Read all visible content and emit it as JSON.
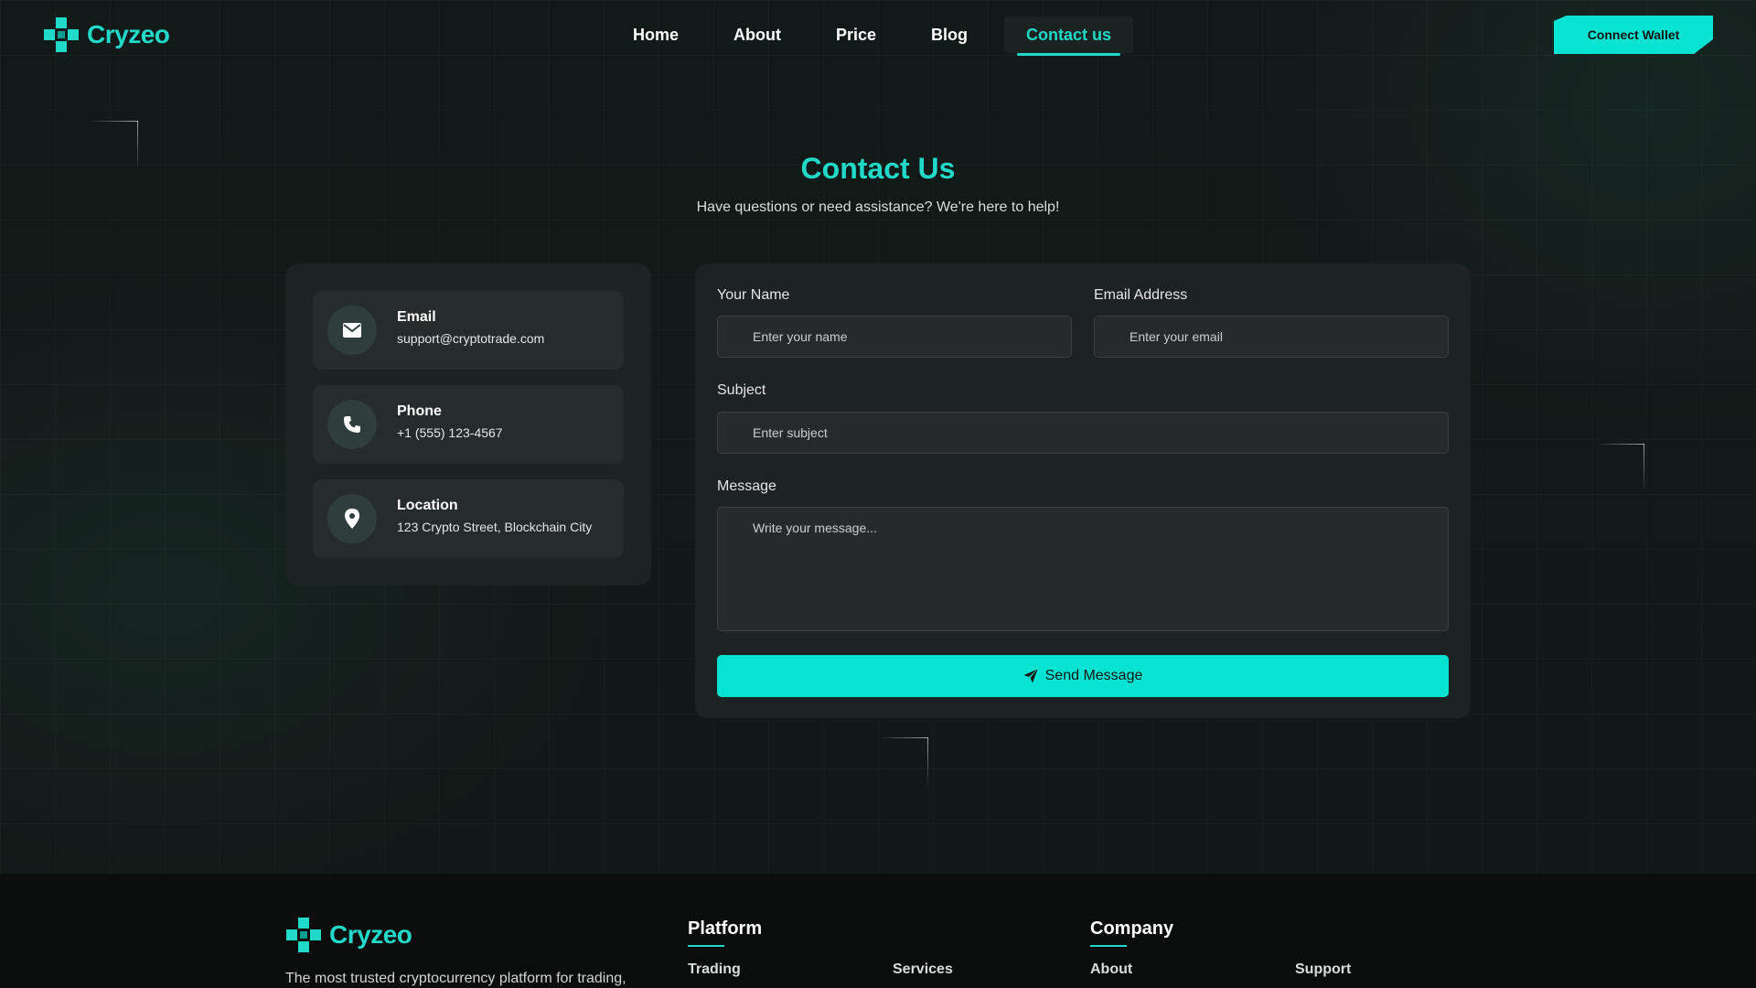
{
  "brand": {
    "name": "Cryzeo",
    "accent": "#20d9c8"
  },
  "nav": {
    "items": [
      {
        "label": "Home"
      },
      {
        "label": "About"
      },
      {
        "label": "Price"
      },
      {
        "label": "Blog"
      },
      {
        "label": "Contact us",
        "active": true
      }
    ],
    "connect_label": "Connect Wallet"
  },
  "hero": {
    "title": "Contact Us",
    "subtitle": "Have questions or need assistance? We're here to help!"
  },
  "contact_info": [
    {
      "label": "Email",
      "value": "support@cryptotrade.com",
      "icon": "envelope-icon"
    },
    {
      "label": "Phone",
      "value": "+1 (555) 123-4567",
      "icon": "phone-icon"
    },
    {
      "label": "Location",
      "value": "123 Crypto Street, Blockchain City",
      "icon": "map-pin-icon"
    }
  ],
  "form": {
    "name_label": "Your Name",
    "name_placeholder": "Enter your name",
    "email_label": "Email Address",
    "email_placeholder": "Enter your email",
    "subject_label": "Subject",
    "subject_placeholder": "Enter subject",
    "message_label": "Message",
    "message_placeholder": "Write your message...",
    "submit_label": "Send Message"
  },
  "footer": {
    "description": "The most trusted cryptocurrency platform for trading,",
    "platform_heading": "Platform",
    "platform_links": [
      "Trading",
      "Services"
    ],
    "company_heading": "Company",
    "company_links": [
      "About",
      "Support"
    ]
  }
}
